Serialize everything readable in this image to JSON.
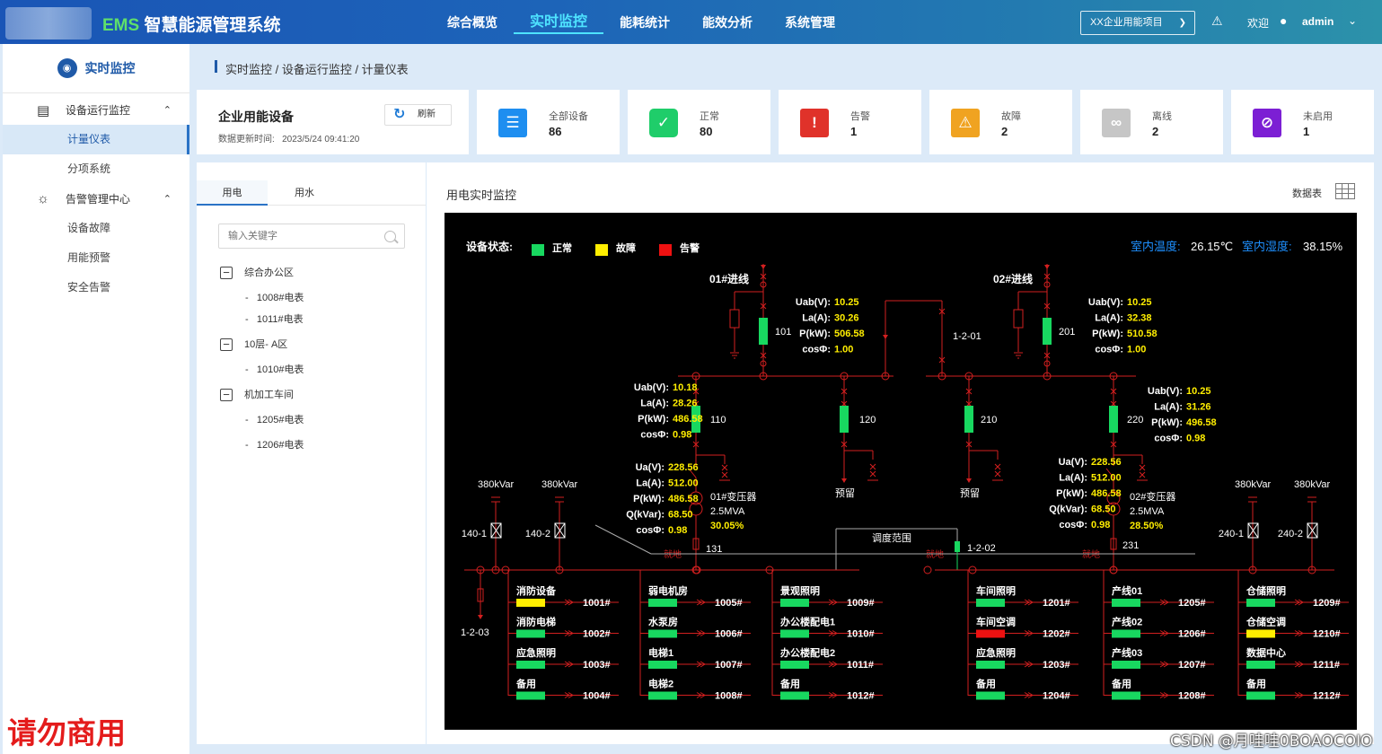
{
  "header": {
    "brand_prefix": "EMS",
    "brand_title": "智慧能源管理系统",
    "nav": [
      "综合概览",
      "实时监控",
      "能耗统计",
      "能效分析",
      "系统管理"
    ],
    "project": "XX企业用能项目",
    "welcome": "欢迎",
    "user": "admin"
  },
  "sidebar": {
    "title": "实时监控",
    "groups": [
      {
        "label": "设备运行监控",
        "items": [
          "计量仪表",
          "分项系统"
        ]
      },
      {
        "label": "告警管理中心",
        "items": [
          "设备故障",
          "用能预警",
          "安全告警"
        ]
      }
    ]
  },
  "breadcrumb": "实时监控 / 设备运行监控 / 计量仪表",
  "summary": {
    "title": "企业用能设备",
    "update_label": "数据更新时间:",
    "update_time": "2023/5/24 09:41:20",
    "refresh": "刷新"
  },
  "stats": [
    {
      "label": "全部设备",
      "value": "86",
      "color": "#1e8ef0"
    },
    {
      "label": "正常",
      "value": "80",
      "color": "#1fcd6a"
    },
    {
      "label": "告警",
      "value": "1",
      "color": "#e0322a"
    },
    {
      "label": "故障",
      "value": "2",
      "color": "#f0a321"
    },
    {
      "label": "离线",
      "value": "2",
      "color": "#c6c6c6"
    },
    {
      "label": "未启用",
      "value": "1",
      "color": "#7c1fd4"
    }
  ],
  "left_panel": {
    "tabs": [
      "用电",
      "用水"
    ],
    "search_placeholder": "输入关键字",
    "tree": [
      {
        "label": "综合办公区",
        "children": [
          "1008#电表",
          "1011#电表"
        ]
      },
      {
        "label": "10层- A区",
        "children": [
          "1010#电表"
        ]
      },
      {
        "label": "机加工车间",
        "children": [
          "1205#电表",
          "1206#电表"
        ]
      }
    ]
  },
  "right_panel": {
    "title": "用电实时监控",
    "data_table": "数据表"
  },
  "diagram": {
    "status_label": "设备状态:",
    "legend": [
      {
        "label": "正常",
        "color": "#18d860"
      },
      {
        "label": "故障",
        "color": "#ffee00"
      },
      {
        "label": "告警",
        "color": "#ee1111"
      }
    ],
    "indoor_temp_label": "室内温度:",
    "indoor_temp": "26.15℃",
    "indoor_humid_label": "室内湿度:",
    "indoor_humid": "38.15%",
    "incoming": [
      "01#进线",
      "02#进线"
    ],
    "breakers": [
      "101",
      "201",
      "110",
      "120",
      "210",
      "220",
      "131",
      "231"
    ],
    "ties": [
      "1-2-01",
      "1-2-02",
      "1-2-03"
    ],
    "reserve": [
      "预留",
      "预留"
    ],
    "capacitors": [
      "380kVar",
      "380kVar",
      "380kVar",
      "380kVar"
    ],
    "cap_switches": [
      "140-1",
      "140-2",
      "240-1",
      "240-2"
    ],
    "dispatch": "调度范围",
    "local": [
      "就地",
      "就地",
      "就地",
      "就地"
    ],
    "meters": [
      {
        "uab": "10.25",
        "ia": "30.26",
        "p": "506.58",
        "cos": "1.00"
      },
      {
        "uab": "10.25",
        "ia": "32.38",
        "p": "510.58",
        "cos": "1.00"
      },
      {
        "uab": "10.18",
        "ia": "28.26",
        "p": "486.58",
        "cos": "0.98"
      },
      {
        "uab": "10.25",
        "ia": "31.26",
        "p": "496.58",
        "cos": "0.98"
      }
    ],
    "transformers": [
      {
        "name": "01#变压器",
        "capacity": "2.5MVA",
        "load": "30.05%",
        "ua": "228.56",
        "ia": "512.00",
        "p": "486.58",
        "q": "68.50",
        "cos": "0.98"
      },
      {
        "name": "02#变压器",
        "capacity": "2.5MVA",
        "load": "28.50%",
        "ua": "228.56",
        "ia": "512.00",
        "p": "486.58",
        "q": "68.50",
        "cos": "0.98"
      }
    ],
    "feeders": [
      {
        "name": "消防设备",
        "id": "1001#",
        "status": "fault"
      },
      {
        "name": "消防电梯",
        "id": "1002#",
        "status": "normal"
      },
      {
        "name": "应急照明",
        "id": "1003#",
        "status": "normal"
      },
      {
        "name": "备用",
        "id": "1004#",
        "status": "normal"
      },
      {
        "name": "弱电机房",
        "id": "1005#",
        "status": "normal"
      },
      {
        "name": "水泵房",
        "id": "1006#",
        "status": "normal"
      },
      {
        "name": "电梯1",
        "id": "1007#",
        "status": "normal"
      },
      {
        "name": "电梯2",
        "id": "1008#",
        "status": "normal"
      },
      {
        "name": "景观照明",
        "id": "1009#",
        "status": "normal"
      },
      {
        "name": "办公楼配电1",
        "id": "1010#",
        "status": "normal"
      },
      {
        "name": "办公楼配电2",
        "id": "1011#",
        "status": "normal"
      },
      {
        "name": "备用",
        "id": "1012#",
        "status": "normal"
      },
      {
        "name": "车间照明",
        "id": "1201#",
        "status": "normal"
      },
      {
        "name": "车间空调",
        "id": "1202#",
        "status": "alarm"
      },
      {
        "name": "应急照明",
        "id": "1203#",
        "status": "normal"
      },
      {
        "name": "备用",
        "id": "1204#",
        "status": "normal"
      },
      {
        "name": "产线01",
        "id": "1205#",
        "status": "normal"
      },
      {
        "name": "产线02",
        "id": "1206#",
        "status": "normal"
      },
      {
        "name": "产线03",
        "id": "1207#",
        "status": "normal"
      },
      {
        "name": "备用",
        "id": "1208#",
        "status": "normal"
      },
      {
        "name": "仓储照明",
        "id": "1209#",
        "status": "normal"
      },
      {
        "name": "仓储空调",
        "id": "1210#",
        "status": "fault"
      },
      {
        "name": "数据中心",
        "id": "1211#",
        "status": "normal"
      },
      {
        "name": "备用",
        "id": "1212#",
        "status": "normal"
      }
    ]
  },
  "watermark": "请勿商用",
  "credit": "CSDN @月哇哇0BOAOCOIO"
}
